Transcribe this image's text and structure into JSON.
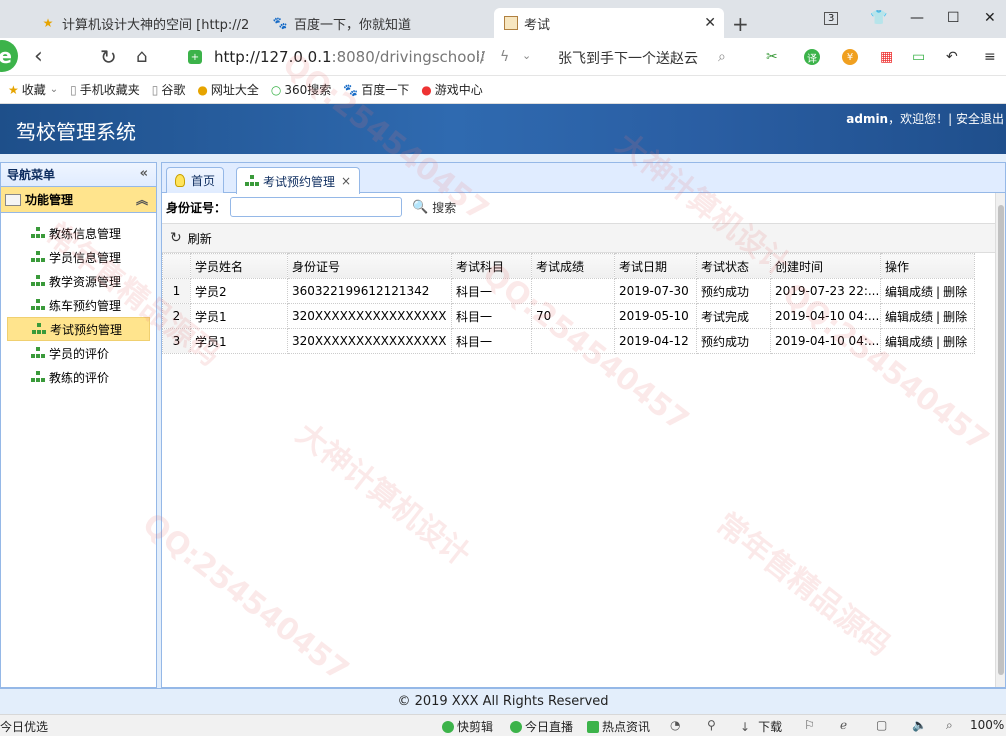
{
  "browser": {
    "tabs": [
      {
        "title": "计算机设计大神的空间 [http://2",
        "icon": "star-icon"
      },
      {
        "title": "百度一下，你就知道",
        "icon": "baidu-paw-icon"
      },
      {
        "title": "考试",
        "icon": "page-icon"
      }
    ],
    "tab_count_badge": "3",
    "url_host": "http://127.0.0.1",
    "url_path": ":8080/drivingschool/",
    "search_hint": "张飞到手下一个送赵云",
    "bookmarks": [
      "收藏",
      "手机收藏夹",
      "谷歌",
      "网址大全",
      "360搜索",
      "百度一下",
      "游戏中心"
    ],
    "status_left": "今日优选",
    "status_items": [
      "快剪辑",
      "今日直播",
      "热点资讯",
      "下载"
    ],
    "zoom": "100%"
  },
  "app": {
    "title": "驾校管理系统",
    "user": "admin",
    "welcome": "，欢迎您！|",
    "logout": "安全退出"
  },
  "sidebar": {
    "title": "导航菜单",
    "section": "功能管理",
    "items": [
      {
        "label": "教练信息管理"
      },
      {
        "label": "学员信息管理"
      },
      {
        "label": "教学资源管理"
      },
      {
        "label": "练车预约管理"
      },
      {
        "label": "考试预约管理"
      },
      {
        "label": "学员的评价"
      },
      {
        "label": "教练的评价"
      }
    ]
  },
  "content_tabs": [
    {
      "label": "首页"
    },
    {
      "label": "考试预约管理",
      "close": "×"
    }
  ],
  "search": {
    "label": "身份证号：",
    "value": "",
    "button": "搜索"
  },
  "toolbar": {
    "refresh": "刷新"
  },
  "table": {
    "columns": [
      "学员姓名",
      "身份证号",
      "考试科目",
      "考试成绩",
      "考试日期",
      "考试状态",
      "创建时间",
      "操作"
    ],
    "rows": [
      {
        "no": "1",
        "name": "学员2",
        "id": "360322199612121342",
        "subject": "科目一",
        "score": "",
        "date": "2019-07-30",
        "status": "预约成功",
        "created": "2019-07-23 22:...",
        "edit": "编辑成绩",
        "delete": "删除"
      },
      {
        "no": "2",
        "name": "学员1",
        "id": "320XXXXXXXXXXXXXXXX",
        "subject": "科目一",
        "score": "70",
        "date": "2019-05-10",
        "status": "考试完成",
        "created": "2019-04-10 04:...",
        "edit": "编辑成绩",
        "delete": "删除"
      },
      {
        "no": "3",
        "name": "学员1",
        "id": "320XXXXXXXXXXXXXXXX",
        "subject": "科目一",
        "score": "",
        "date": "2019-04-12",
        "status": "预约成功",
        "created": "2019-04-10 04:...",
        "edit": "编辑成绩",
        "delete": "删除"
      }
    ]
  },
  "footer": "© 2019 XXX All Rights Reserved",
  "watermarks": [
    "QQ:254540457",
    "大神计算机设计",
    "常年售精品源码"
  ]
}
